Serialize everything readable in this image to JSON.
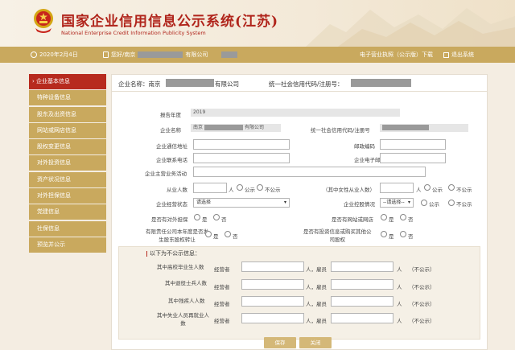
{
  "header": {
    "title_cn": "国家企业信用信息公示系统(江苏)",
    "title_en": "National Enterprise Credit Information Publicity System"
  },
  "topbar": {
    "date": "2020年2月4日",
    "greeting_prefix": "您好/南京",
    "greeting_suffix": "有限公司",
    "download": "电子营业执照（公示版）下载",
    "logout": "退出系统"
  },
  "sidebar": {
    "items": [
      {
        "label": "› 企业基本信息",
        "active": true
      },
      {
        "label": "特种设备信息"
      },
      {
        "label": "股东及出资信息"
      },
      {
        "label": "网站或网店信息"
      },
      {
        "label": "股权变更信息"
      },
      {
        "label": "对外投资信息"
      },
      {
        "label": "资产状况信息"
      },
      {
        "label": "对外担保信息"
      },
      {
        "label": "党建信息"
      },
      {
        "label": "社保信息"
      },
      {
        "label": "预览并公示"
      }
    ]
  },
  "panel_head": {
    "company_label": "企业名称：南京",
    "company_suffix": "有限公司",
    "credit_label": "统一社会信用代码/注册号："
  },
  "form": {
    "report_year_label": "报告年度",
    "report_year": "2019",
    "name_label": "企业名称",
    "name_value_prefix": "南京",
    "name_value_suffix": "有限公司",
    "credit_label": "统一社会信用代码/注册号",
    "address_label": "企业通信地址",
    "postcode_label": "邮政编码",
    "phone_label": "企业联系电话",
    "email_label": "企业电子邮箱",
    "business_label": "企业主营业务活动",
    "employees_label": "从业人数",
    "person_unit": "人",
    "public": "公示",
    "not_public": "不公示",
    "female_label": "（其中女性从业人数）",
    "status_label": "企业经营状态",
    "status_placeholder": "请选择",
    "holding_label": "企业控股情况",
    "holding_placeholder": "--请选择--",
    "guarantee_label": "是否有对外担保",
    "website_label": "是否有网站或网店",
    "equity_transfer_label_1": "有限责任公司本年度是否发",
    "equity_transfer_label_2": "生股东股权转让",
    "investment_label_1": "是否有投资信息或购买其他公",
    "investment_label_2": "司股权",
    "yes": "是",
    "no": "否"
  },
  "subsection": {
    "title": "以下为不公示信息：",
    "operator": "经营者",
    "employee": "人，雇员",
    "unit": "人",
    "not_public_paren": "（不公示）",
    "rows": [
      {
        "label_1": "其中高校毕业生人数",
        "label_2": ""
      },
      {
        "label_1": "其中退役士兵人数",
        "label_2": ""
      },
      {
        "label_1": "其中残疾人人数",
        "label_2": ""
      },
      {
        "label_1": "其中失业人员再就业人",
        "label_2": "数"
      }
    ]
  },
  "buttons": {
    "save": "保存",
    "close": "关闭"
  },
  "colors": {
    "gold": "#c9a95e",
    "red": "#b72a1e",
    "title_red": "#b0241b"
  }
}
